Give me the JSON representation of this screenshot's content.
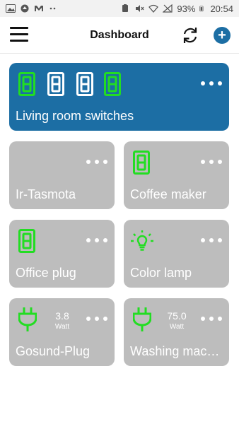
{
  "status_bar": {
    "battery": "93%",
    "time": "20:54"
  },
  "app_bar": {
    "title": "Dashboard",
    "icons": [
      "menu-icon",
      "refresh-icon",
      "add-icon"
    ],
    "accent": "#1c6ea4"
  },
  "tiles": {
    "living_room": {
      "label": "Living room switches",
      "switch_count": 4
    },
    "ir_tasmota": {
      "label": "Ir-Tasmota"
    },
    "coffee_maker": {
      "label": "Coffee maker"
    },
    "office_plug": {
      "label": "Office plug"
    },
    "color_lamp": {
      "label": "Color lamp"
    },
    "gosund_plug": {
      "label": "Gosund-Plug",
      "value": "3.8",
      "unit": "Watt"
    },
    "washing_machine": {
      "label": "Washing machine",
      "value": "75.0",
      "unit": "Watt"
    }
  },
  "colors": {
    "on_green": "#22dd22",
    "tile_grey": "#bdbdbd",
    "tile_blue": "#1c6ea4"
  }
}
